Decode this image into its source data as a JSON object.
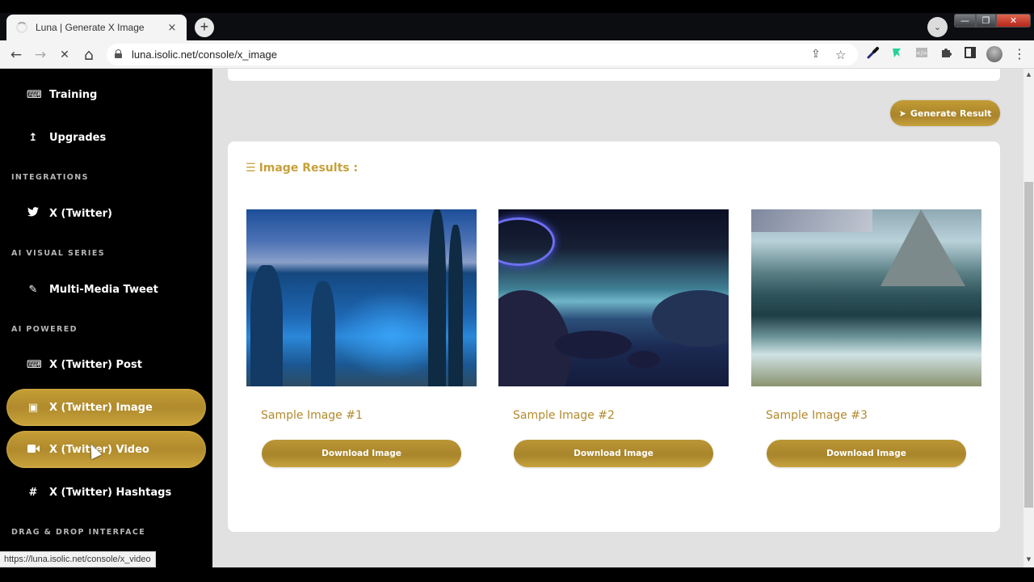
{
  "browser": {
    "tab_title": "Luna | Generate X Image",
    "tab_close_icon": "×",
    "new_tab_icon": "+",
    "tab_search_icon": "⌄",
    "url": "luna.isolic.net/console/x_image",
    "status_url": "https://luna.isolic.net/console/x_video",
    "window_controls": {
      "minimize": "—",
      "maximize": "❐",
      "close": "✕"
    },
    "nav": {
      "back": "←",
      "forward": "→",
      "stop": "✕",
      "home": "⌂"
    },
    "omni_icons": {
      "share": "⇪",
      "star": "☆"
    },
    "extensions": [
      "eyedropper",
      "tag",
      "code",
      "puzzle",
      "side-panel"
    ],
    "menu_icon": "⋮"
  },
  "sidebar": {
    "items_top": [
      {
        "label": "Training",
        "icon": "⌨"
      },
      {
        "label": "Upgrades",
        "icon": "↥"
      }
    ],
    "sections": [
      {
        "title": "INTEGRATIONS",
        "items": [
          {
            "label": "X (Twitter)",
            "icon": "🐦"
          }
        ]
      },
      {
        "title": "AI VISUAL SERIES",
        "items": [
          {
            "label": "Multi-Media Tweet",
            "icon": "✎"
          }
        ]
      },
      {
        "title": "AI POWERED",
        "items": [
          {
            "label": "X (Twitter) Post",
            "icon": "⌨",
            "active": false
          },
          {
            "label": "X (Twitter) Image",
            "icon": "▣",
            "active": true
          },
          {
            "label": "X (Twitter) Video",
            "icon": "■",
            "active": true,
            "hovered": true
          },
          {
            "label": "X (Twitter) Hashtags",
            "icon": "#",
            "active": false
          }
        ]
      },
      {
        "title": "DRAG & DROP INTERFACE",
        "items": []
      }
    ]
  },
  "main": {
    "generate_button": {
      "label": "Generate Result",
      "icon": "➤"
    },
    "results": {
      "title": "Image Results :",
      "title_icon": "☰",
      "cards": [
        {
          "title": "Sample Image #1",
          "download_label": "Download Image"
        },
        {
          "title": "Sample Image #2",
          "download_label": "Download Image"
        },
        {
          "title": "Sample Image #3",
          "download_label": "Download Image"
        }
      ]
    }
  },
  "colors": {
    "accent_gold": "#c39c35",
    "title_gold": "#c7a03b",
    "sidebar_bg": "#000000",
    "page_bg": "#e1e1e1"
  }
}
